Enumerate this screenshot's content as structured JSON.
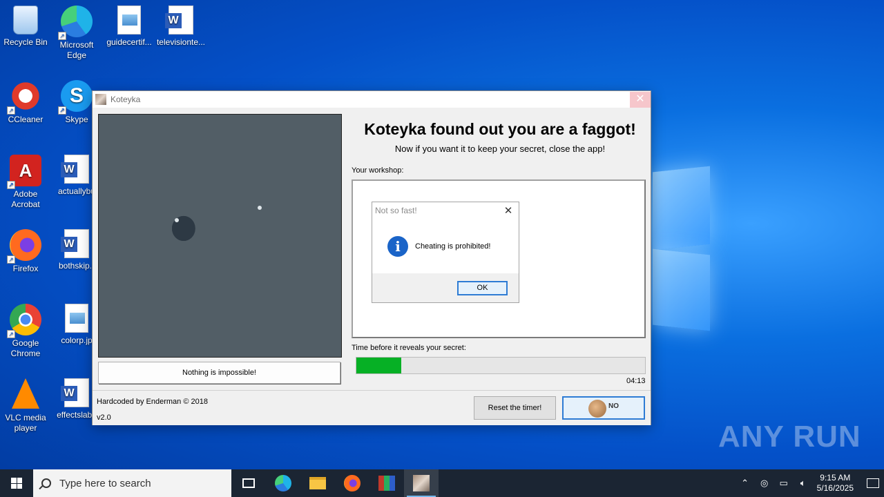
{
  "desktop": {
    "icons": [
      {
        "label": "Recycle Bin"
      },
      {
        "label": "Microsoft Edge"
      },
      {
        "label": "guidecertif..."
      },
      {
        "label": "televisionte..."
      },
      {
        "label": "CCleaner"
      },
      {
        "label": "Skype"
      },
      {
        "label": "Adobe Acrobat"
      },
      {
        "label": "actuallybu"
      },
      {
        "label": "Firefox"
      },
      {
        "label": "bothskip.r"
      },
      {
        "label": "Google Chrome"
      },
      {
        "label": "colorp.jp"
      },
      {
        "label": "VLC media player"
      },
      {
        "label": "effectslabe"
      }
    ],
    "watermark": "ANY RUN"
  },
  "app": {
    "title": "Koteyka",
    "heading": "Koteyka found out you are a faggot!",
    "subheading": "Now if you want it to keep your secret, close the app!",
    "workshop_label": "Your workshop:",
    "nothing_button": "Nothing is impossible!",
    "timer_label": "Time before it reveals your secret:",
    "timer_value": "04:13",
    "progress_fraction": 0.155,
    "progress_color": "#06b025",
    "credit": "Hardcoded by Enderman © 2018",
    "version": "v2.0",
    "reset_button": "Reset the timer!",
    "nope_button_text": "NO"
  },
  "dialog": {
    "title": "Not so fast!",
    "message": "Cheating is prohibited!",
    "ok_label": "OK",
    "icon": "info-icon"
  },
  "taskbar": {
    "search_placeholder": "Type here to search",
    "time": "9:15 AM",
    "date": "5/16/2025"
  }
}
